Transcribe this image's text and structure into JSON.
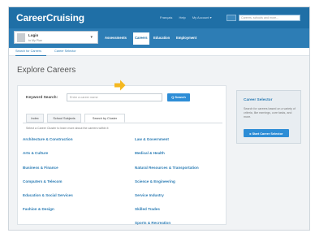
{
  "header": {
    "logo": "CareerCruising",
    "links": [
      "Français",
      "Help",
      "My Account ▾"
    ],
    "search_placeholder": "Careers, schools and more..."
  },
  "user": {
    "name": "Login",
    "sub": "to My Plan"
  },
  "nav": {
    "tabs": [
      "Assessments",
      "Careers",
      "Education",
      "Employment"
    ],
    "active": "Careers"
  },
  "subnav": {
    "items": [
      "Search for Careers",
      "Career Selector"
    ]
  },
  "page": {
    "title": "Explore Careers"
  },
  "keyword": {
    "label": "Keyword Search:",
    "placeholder": "Enter a career name",
    "button": "Q Search"
  },
  "tabs": [
    "Index",
    "School Subjects",
    "Search by Cluster"
  ],
  "instructions": "Select a Career Cluster to learn more about the careers within it",
  "clusters_left": [
    "Architecture & Construction",
    "Arts & Culture",
    "Business & Finance",
    "Computers & Telecom",
    "Education & Social Services",
    "Fashion & Design"
  ],
  "clusters_right": [
    "Law & Government",
    "Medical & Health",
    "Natural Resources & Transportation",
    "Science & Engineering",
    "Service Industry",
    "Skilled Trades",
    "Sports & Recreation"
  ],
  "sidebar": {
    "title": "Career Selector",
    "text": "Search for careers based on a variety of criteria, like earnings, core tasks, and more.",
    "button": "▸ Start Career Selector"
  },
  "colors": {
    "brand": "#1f6fa6",
    "link": "#2d7db5",
    "accent": "#f5b820"
  }
}
